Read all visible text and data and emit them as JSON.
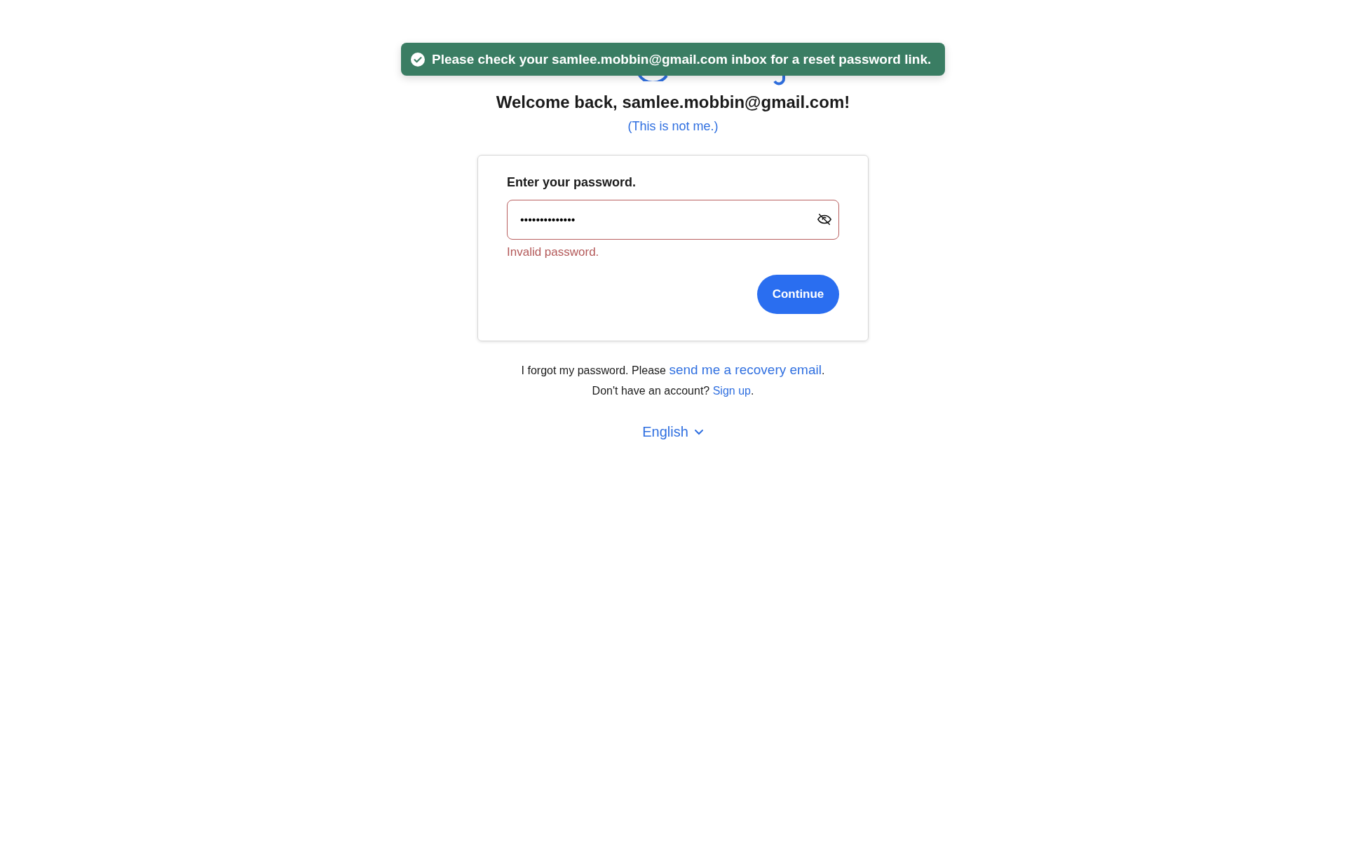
{
  "toast": {
    "message": "Please check your samlee.mobbin@gmail.com inbox for a reset password link."
  },
  "heading": "Welcome back, samlee.mobbin@gmail.com!",
  "not_me_link": "(This is not me.)",
  "card": {
    "label": "Enter your password.",
    "password": {
      "value": "••••••••••••••",
      "invalid": true
    },
    "error": "Invalid password.",
    "button": "Continue"
  },
  "forgot": {
    "text": "I forgot my password. Please",
    "link": "send me a recovery email",
    "end": "."
  },
  "signup": {
    "text": "Don't have an account?",
    "link": "Sign up",
    "end": "."
  },
  "language": "English"
}
